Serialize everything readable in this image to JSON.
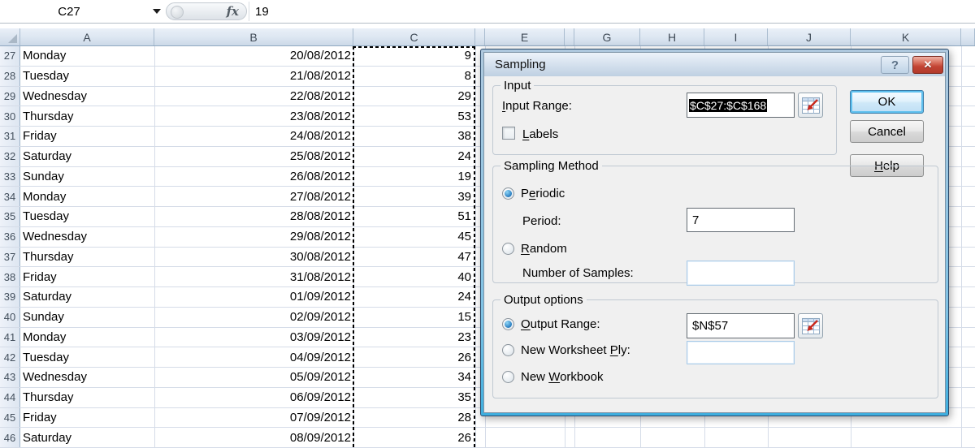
{
  "formula_bar": {
    "cell_reference": "C27",
    "fx_label": "fx",
    "formula_value": "19"
  },
  "sheet": {
    "columns": [
      "A",
      "B",
      "C",
      "",
      "E",
      "",
      "G",
      "H",
      "I",
      "J",
      "K",
      ""
    ],
    "rows": [
      {
        "n": "27",
        "day": "Monday",
        "date": "20/08/2012",
        "value": "9"
      },
      {
        "n": "28",
        "day": "Tuesday",
        "date": "21/08/2012",
        "value": "8"
      },
      {
        "n": "29",
        "day": "Wednesday",
        "date": "22/08/2012",
        "value": "29"
      },
      {
        "n": "30",
        "day": "Thursday",
        "date": "23/08/2012",
        "value": "53"
      },
      {
        "n": "31",
        "day": "Friday",
        "date": "24/08/2012",
        "value": "38"
      },
      {
        "n": "32",
        "day": "Saturday",
        "date": "25/08/2012",
        "value": "24"
      },
      {
        "n": "33",
        "day": "Sunday",
        "date": "26/08/2012",
        "value": "19"
      },
      {
        "n": "34",
        "day": "Monday",
        "date": "27/08/2012",
        "value": "39"
      },
      {
        "n": "35",
        "day": "Tuesday",
        "date": "28/08/2012",
        "value": "51"
      },
      {
        "n": "36",
        "day": "Wednesday",
        "date": "29/08/2012",
        "value": "45"
      },
      {
        "n": "37",
        "day": "Thursday",
        "date": "30/08/2012",
        "value": "47"
      },
      {
        "n": "38",
        "day": "Friday",
        "date": "31/08/2012",
        "value": "40"
      },
      {
        "n": "39",
        "day": "Saturday",
        "date": "01/09/2012",
        "value": "24"
      },
      {
        "n": "40",
        "day": "Sunday",
        "date": "02/09/2012",
        "value": "15"
      },
      {
        "n": "41",
        "day": "Monday",
        "date": "03/09/2012",
        "value": "23"
      },
      {
        "n": "42",
        "day": "Tuesday",
        "date": "04/09/2012",
        "value": "26"
      },
      {
        "n": "43",
        "day": "Wednesday",
        "date": "05/09/2012",
        "value": "34"
      },
      {
        "n": "44",
        "day": "Thursday",
        "date": "06/09/2012",
        "value": "35"
      },
      {
        "n": "45",
        "day": "Friday",
        "date": "07/09/2012",
        "value": "28"
      },
      {
        "n": "46",
        "day": "Saturday",
        "date": "08/09/2012",
        "value": "26"
      }
    ]
  },
  "dialog": {
    "title": "Sampling",
    "titlebar": {
      "help_glyph": "?",
      "close_glyph": "✕"
    },
    "input": {
      "group_label": "Input",
      "input_range_label": {
        "text": "Input Range:",
        "accel": 0
      },
      "input_range_value": "$C$27:$C$168",
      "labels_label": {
        "text": "Labels",
        "accel": 0
      },
      "labels_checked": false
    },
    "buttons": {
      "ok": "OK",
      "cancel": "Cancel",
      "help": {
        "text": "Help",
        "accel": 0
      }
    },
    "sampling_method": {
      "group_label": "Sampling Method",
      "periodic_label": {
        "text": "Periodic",
        "accel": 1
      },
      "periodic_selected": true,
      "period_label": {
        "text": "Period:",
        "accel": -1
      },
      "period_value": "7",
      "random_label": {
        "text": "Random",
        "accel": 0
      },
      "random_selected": false,
      "number_of_samples_label": {
        "text": "Number of Samples:",
        "accel": -1
      },
      "number_of_samples_value": ""
    },
    "output_options": {
      "group_label": "Output options",
      "output_range_label": {
        "text": "Output Range:",
        "accel": 0
      },
      "output_range_selected": true,
      "output_range_value": "$N$57",
      "new_worksheet_label": {
        "text": "New Worksheet Ply:",
        "accel": 14
      },
      "new_worksheet_value": "",
      "new_workbook_label": {
        "text": "New Workbook",
        "accel": 4
      },
      "new_workbook_selected": false
    }
  },
  "colors": {
    "gridline": "#d5dce8",
    "marching_ants": "#000000",
    "selection_text_bg": "#000000",
    "close_button_red": "#c24434",
    "ok_focus_blue": "#5fc0ee",
    "dialog_face": "#f0f0f0",
    "range_picker_arrow_red": "#c9281c"
  }
}
